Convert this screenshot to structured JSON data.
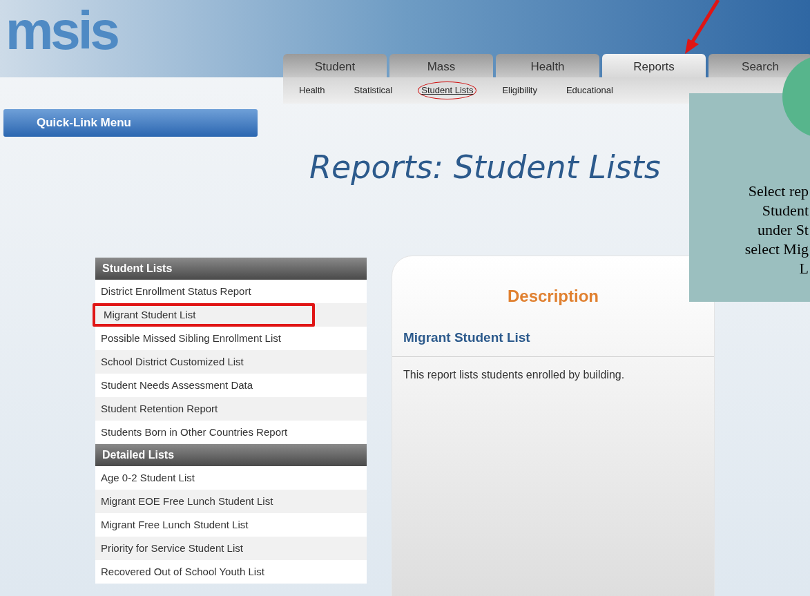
{
  "logo": {
    "text": "msis"
  },
  "tabs": [
    {
      "label": "Student",
      "selected": false
    },
    {
      "label": "Mass",
      "selected": false
    },
    {
      "label": "Health",
      "selected": false
    },
    {
      "label": "Reports",
      "selected": true
    },
    {
      "label": "Search",
      "selected": false
    }
  ],
  "subtabs": [
    {
      "label": "Health",
      "selected": false,
      "circled": false
    },
    {
      "label": "Statistical",
      "selected": false,
      "circled": false
    },
    {
      "label": "Student Lists",
      "selected": true,
      "circled": true
    },
    {
      "label": "Eligibility",
      "selected": false,
      "circled": false
    },
    {
      "label": "Educational",
      "selected": false,
      "circled": false
    }
  ],
  "quick_link_menu": {
    "label": "Quick-Link Menu"
  },
  "page_title": "Reports: Student Lists",
  "lists": [
    {
      "heading": "Student Lists",
      "items": [
        {
          "label": "District Enrollment Status Report",
          "highlighted": false
        },
        {
          "label": "Migrant Student List",
          "highlighted": true
        },
        {
          "label": "Possible Missed Sibling Enrollment List",
          "highlighted": false
        },
        {
          "label": "School District Customized List",
          "highlighted": false
        },
        {
          "label": "Student Needs Assessment Data",
          "highlighted": false
        },
        {
          "label": "Student Retention Report",
          "highlighted": false
        },
        {
          "label": "Students Born in Other Countries Report",
          "highlighted": false
        }
      ]
    },
    {
      "heading": "Detailed Lists",
      "items": [
        {
          "label": "Age 0-2 Student List",
          "highlighted": false
        },
        {
          "label": "Migrant EOE Free Lunch Student List",
          "highlighted": false
        },
        {
          "label": "Migrant Free Lunch Student List",
          "highlighted": false
        },
        {
          "label": "Priority for Service Student List",
          "highlighted": false
        },
        {
          "label": "Recovered Out of School Youth List",
          "highlighted": false
        }
      ]
    }
  ],
  "description": {
    "title": "Description",
    "report_name": "Migrant Student List",
    "text": "This report lists students enrolled by building."
  },
  "annotation": {
    "lines": [
      "Select rep",
      "Student",
      "under St",
      "select Mig",
      "L"
    ]
  }
}
